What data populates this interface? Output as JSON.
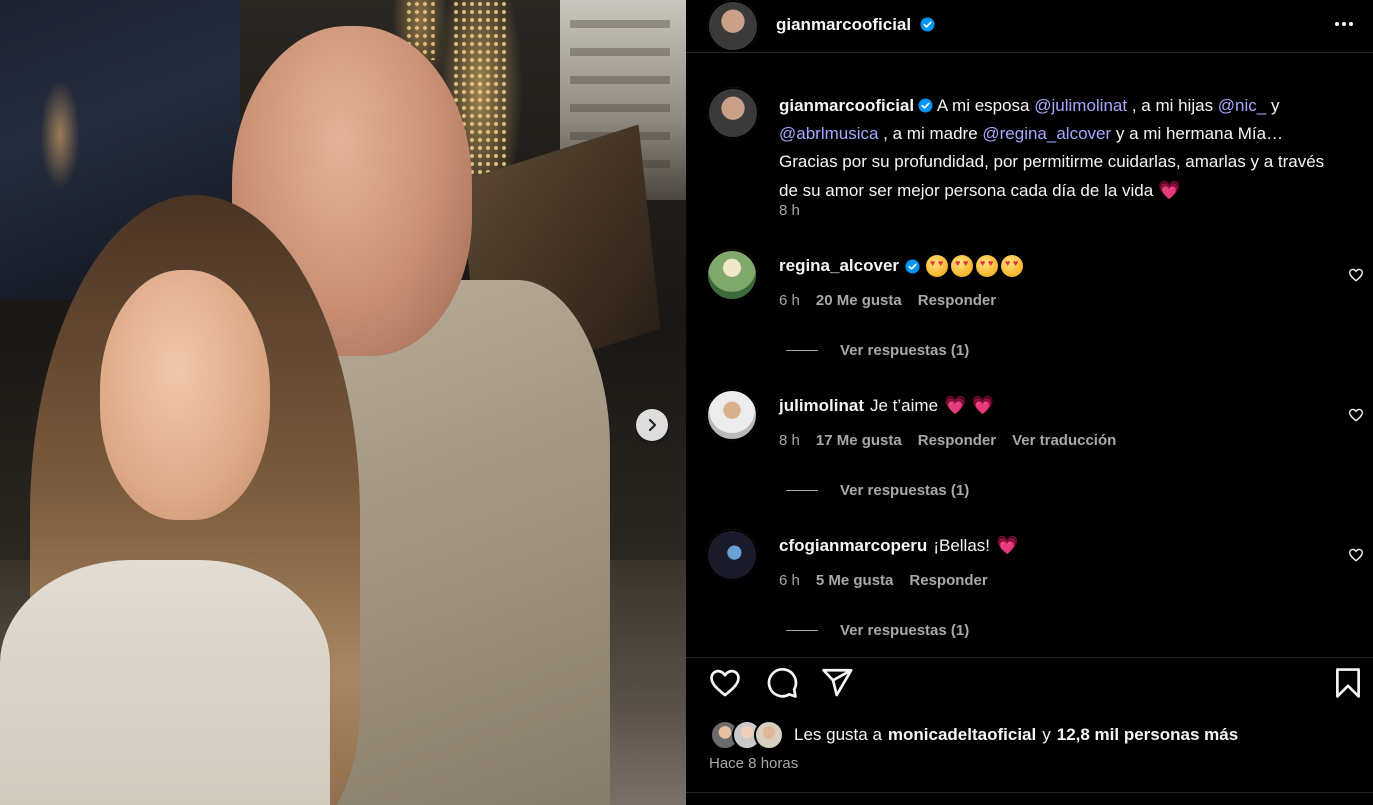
{
  "post": {
    "author": "gianmarcooficial",
    "caption": {
      "t1": "A mi esposa ",
      "m1": "@julimolinat",
      "t2": " , a mi hijas ",
      "m2": "@nic_",
      "t3": " y ",
      "m3": "@abrlmusica",
      "t4": " , a mi madre ",
      "m4": "@regina_alcover",
      "t5": " y a mi hermana Mía… Gracias por su profundidad, por permitirme cuidarlas, amarlas y a través de su amor ser mejor persona cada día de la vida ",
      "emoji": "💗"
    },
    "caption_time": "8 h"
  },
  "comments": [
    {
      "user": "regina_alcover",
      "verified": true,
      "text": "",
      "emojis": "😍😍😍😍",
      "time": "6 h",
      "likes": "20 Me gusta",
      "reply": "Responder",
      "translate": "",
      "view_replies": "Ver respuestas (1)"
    },
    {
      "user": "julimolinat",
      "verified": false,
      "text": "Je t’aime",
      "emojis": "💗 💗",
      "time": "8 h",
      "likes": "17 Me gusta",
      "reply": "Responder",
      "translate": "Ver traducción",
      "view_replies": "Ver respuestas (1)"
    },
    {
      "user": "cfogianmarcoperu",
      "verified": false,
      "text": "¡Bellas!",
      "emojis": "💗",
      "time": "6 h",
      "likes": "5 Me gusta",
      "reply": "Responder",
      "translate": "",
      "view_replies": "Ver respuestas (1)"
    }
  ],
  "likes": {
    "prefix": "Les gusta a",
    "user": "monicadeltaoficial",
    "mid": "y",
    "count": "12,8 mil personas más"
  },
  "posted": "Hace 8 horas",
  "colors": {
    "background": "#000000",
    "text": "#f5f5f5",
    "secondary": "#a8a8a8",
    "mention": "#a5a8ff",
    "verified": "#0095f6",
    "heart": "#ff3f7a"
  },
  "icons": [
    "more-icon",
    "verified-icon",
    "chevron-right-icon",
    "heart-icon",
    "comment-icon",
    "share-icon",
    "bookmark-icon"
  ]
}
